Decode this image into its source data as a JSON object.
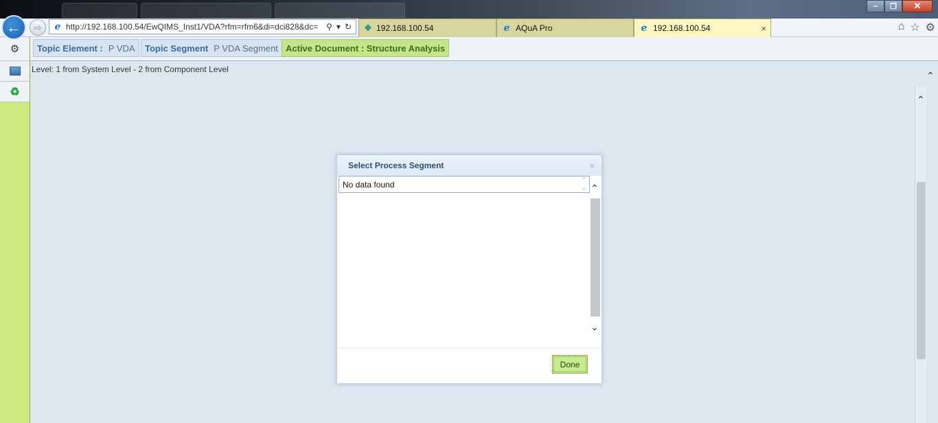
{
  "browser": {
    "address_url": "http://192.168.100.54/EwQIMS_Inst1/VDA?rfm=rfm6&di=dci828&dc=",
    "tabs": [
      {
        "label": "192.168.100.54",
        "active": false
      },
      {
        "label": "AQuA Pro",
        "active": false
      },
      {
        "label": "192.168.100.54",
        "active": true
      }
    ],
    "close_glyph": "×",
    "window_buttons": {
      "minimize": "‒",
      "maximize": "❐",
      "close": "✕"
    },
    "right_icons": [
      "home-icon",
      "star-icon",
      "gear-icon"
    ]
  },
  "toolbar": {
    "topic_element_label": "Topic Element :",
    "topic_element_value": "P VDA",
    "topic_segment_label": "Topic Segment",
    "topic_segment_value": "P VDA Segment",
    "active_document_label": "Active Document : Structure Analysis"
  },
  "main": {
    "level_text": "Level: 1 from System Level - 2 from Component Level"
  },
  "dialog": {
    "title": "Select Process Segment",
    "close_glyph": "×",
    "combo_value": "No data found",
    "done_label": "Done"
  },
  "colors": {
    "sidebar": "#cde980",
    "active_tab": "#fdf8c2",
    "done_button": "#c9ea8e",
    "page_background": "#dde7f0"
  }
}
